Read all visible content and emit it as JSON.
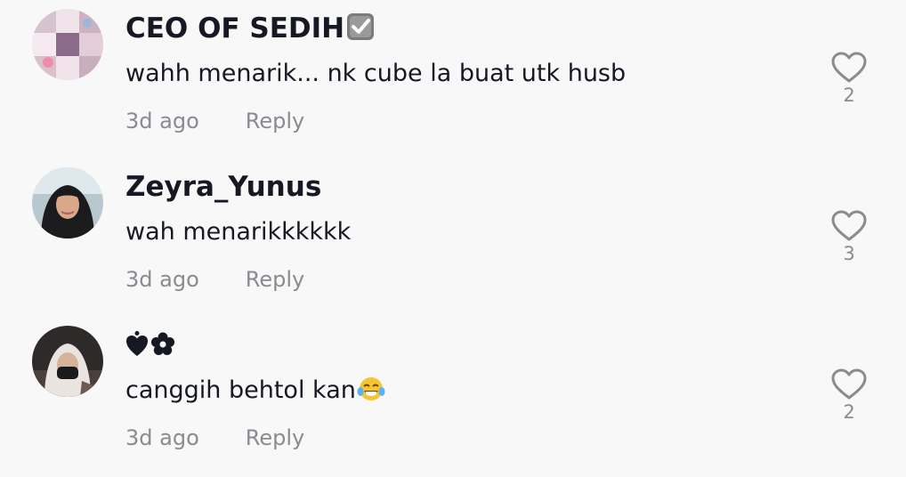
{
  "comments": [
    {
      "username": "CEO OF SEDIH",
      "username_badge_icon": "verified-checkbox-icon",
      "text": "wahh menarik... nk cube la buat utk husb",
      "time": "3d ago",
      "reply_label": "Reply",
      "likes": "2",
      "like_icon": "heart-outline-icon"
    },
    {
      "username": "Zeyra_Yunus",
      "text": "wah menarikkkkkk",
      "time": "3d ago",
      "reply_label": "Reply",
      "likes": "3",
      "like_icon": "heart-outline-icon"
    },
    {
      "username_icons": [
        "heart-exclamation-icon",
        "flower-icon"
      ],
      "text": "canggih behtol kan",
      "text_emoji": "tears-of-joy-emoji",
      "time": "3d ago",
      "reply_label": "Reply",
      "likes": "2",
      "like_icon": "heart-outline-icon"
    }
  ]
}
